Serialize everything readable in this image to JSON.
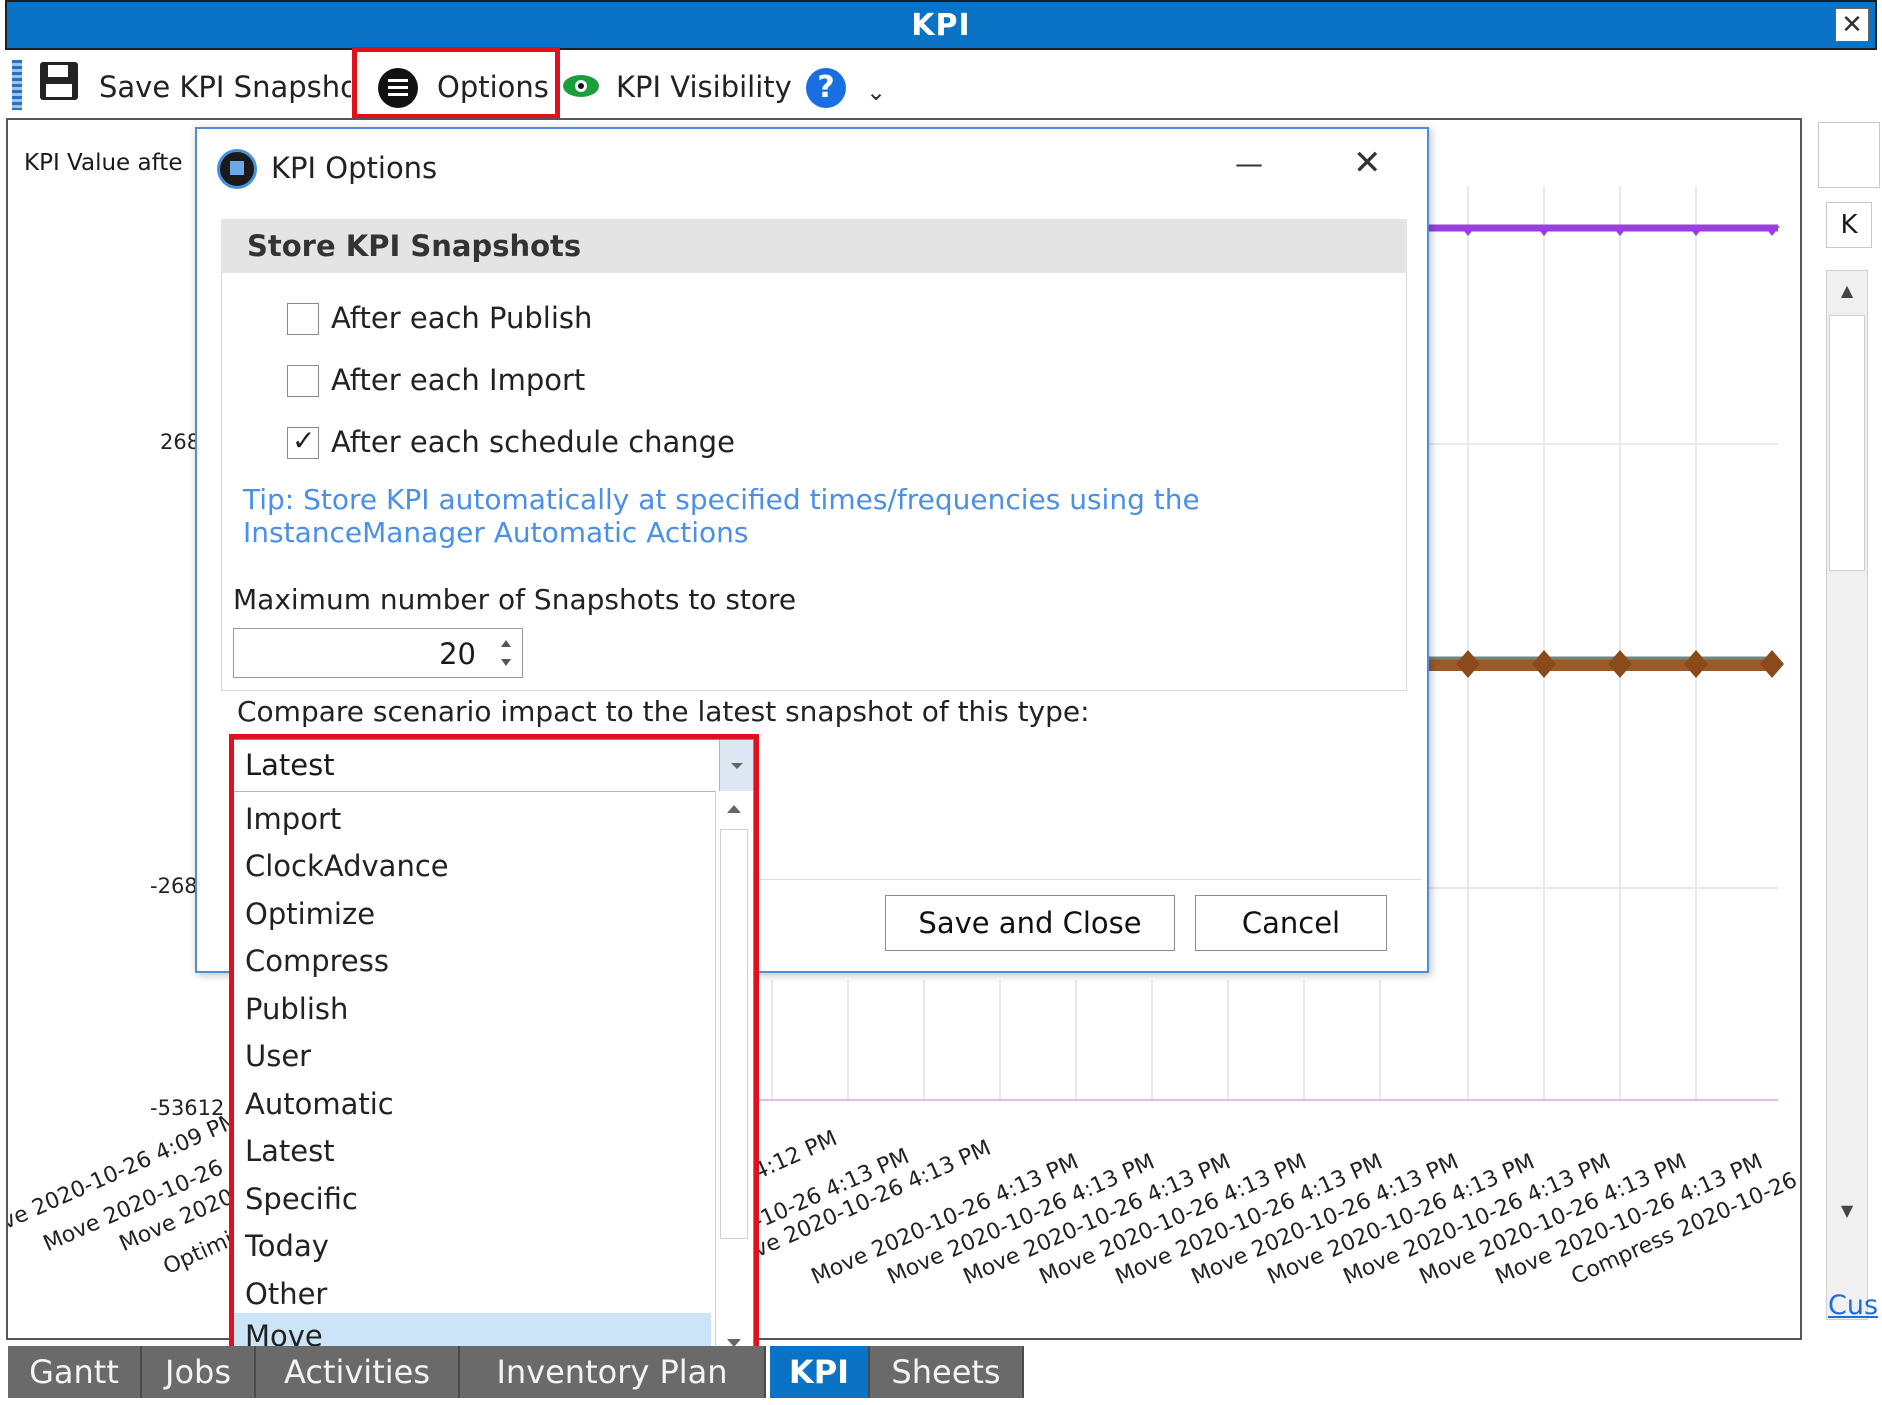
{
  "window": {
    "title": "KPI",
    "close_glyph": "✕"
  },
  "toolbar": {
    "save_label": "Save KPI Snapshot",
    "options_label": "Options",
    "visibility_label": "KPI Visibility",
    "help_glyph": "?",
    "overflow_glyph": "⌄"
  },
  "chart": {
    "title": "KPI Value afte",
    "y_ticks": [
      "268",
      "-268",
      "-53612"
    ],
    "x_labels_left": [
      "ve 2020-10-26 4:09 PM",
      "Move 2020-10-26",
      "Move 2020",
      "Optimi"
    ],
    "x_labels_right": [
      "4:12 PM",
      "-10-26 4:13 PM",
      "ve 2020-10-26 4:13 PM",
      "Move 2020-10-26 4:13 PM",
      "Move 2020-10-26 4:13 PM",
      "Move 2020-10-26 4:13 PM",
      "Move 2020-10-26 4:13 PM",
      "Move 2020-10-26 4:13 PM",
      "Move 2020-10-26 4:13 PM",
      "Move 2020-10-26 4:13 PM",
      "Move 2020-10-26 4:13 PM",
      "Move 2020-10-26 4:13 PM",
      "Move 2020-10-26 4:13 PM",
      "Compress 2020-10-26 4:13 PM"
    ],
    "series_colors": {
      "purple": "#9b3fe0",
      "brown": "#9a5a2a",
      "pink": "#e8b8e8"
    }
  },
  "right_panel": {
    "tab_label": "K",
    "link": "Cus"
  },
  "dialog": {
    "title": "KPI Options",
    "minimize_glyph": "—",
    "close_glyph": "✕",
    "section_title": "Store KPI Snapshots",
    "checkboxes": [
      {
        "label": "After each Publish",
        "checked": false
      },
      {
        "label": "After each Import",
        "checked": false
      },
      {
        "label": "After each schedule change",
        "checked": true
      }
    ],
    "check_glyph": "✓",
    "tip": "Tip: Store KPI automatically at specified times/frequencies using the InstanceManager Automatic Actions",
    "max_label": "Maximum number of Snapshots to store",
    "max_value": "20",
    "compare_label": "Compare scenario impact to the latest snapshot of this type:",
    "save_button": "Save and Close",
    "cancel_button": "Cancel"
  },
  "dropdown": {
    "selected": "Latest",
    "options": [
      "Import",
      "ClockAdvance",
      "Optimize",
      "Compress",
      "Publish",
      "User",
      "Automatic",
      "Latest",
      "Specific",
      "Today",
      "Other",
      "Move"
    ],
    "highlighted": "Move"
  },
  "tabs": [
    {
      "label": "Gantt",
      "active": false
    },
    {
      "label": "Jobs",
      "active": false
    },
    {
      "label": "Activities",
      "active": false
    },
    {
      "label": "Inventory Plan",
      "active": false
    },
    {
      "label": "KPI",
      "active": true
    },
    {
      "label": "Sheets",
      "active": false
    }
  ],
  "colors": {
    "title_bar": "#0a73c6",
    "highlight": "#e0101c",
    "tip": "#4a8fe8",
    "tab_bg": "#6a6a6a"
  }
}
